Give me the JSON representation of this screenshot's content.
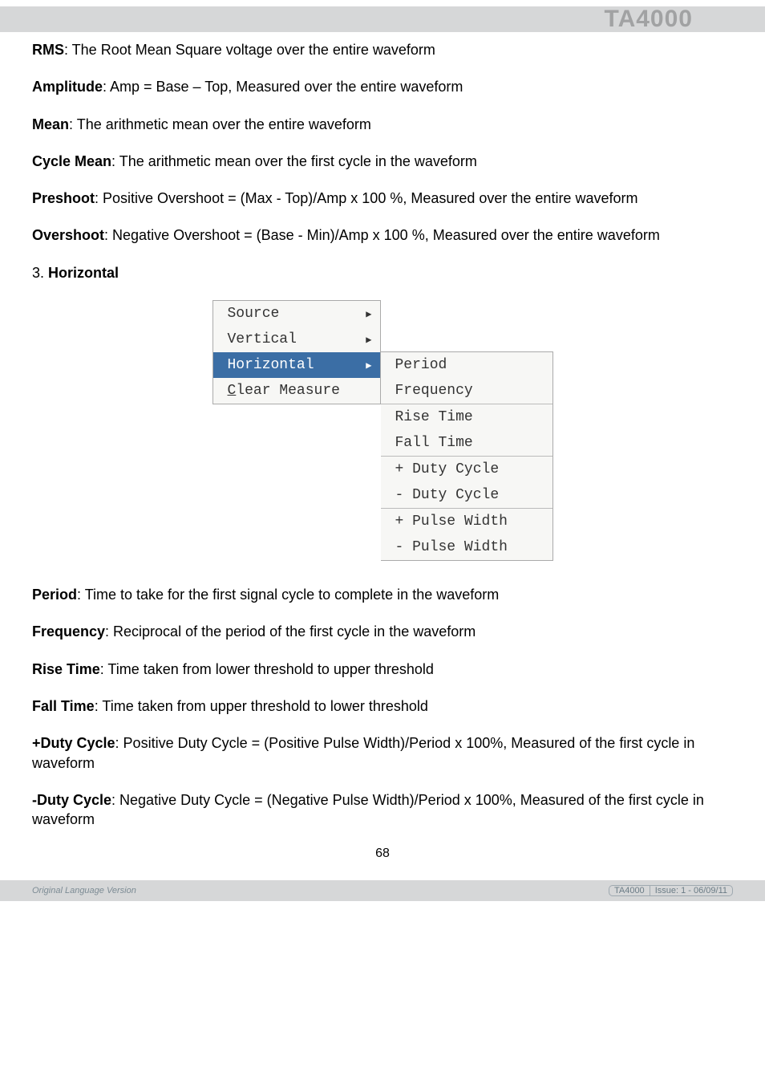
{
  "header": {
    "title": "TA4000"
  },
  "defs": {
    "rms": {
      "term": "RMS",
      "text": ": The Root Mean Square voltage over the entire waveform"
    },
    "amplitude": {
      "term": "Amplitude",
      "text": ": Amp = Base – Top, Measured over the entire waveform"
    },
    "mean": {
      "term": "Mean",
      "text": ": The arithmetic mean over the entire waveform"
    },
    "cycle_mean": {
      "term": "Cycle Mean",
      "text": ": The arithmetic mean over the first cycle in the waveform"
    },
    "preshoot": {
      "term": "Preshoot",
      "text": ": Positive Overshoot = (Max - Top)/Amp x 100 %, Measured over the entire waveform"
    },
    "overshoot": {
      "term": "Overshoot",
      "text": ": Negative Overshoot = (Base - Min)/Amp x 100 %, Measured over the entire waveform"
    }
  },
  "section": {
    "num": "3. ",
    "title": "Horizontal"
  },
  "menu": {
    "left": {
      "source": "Source",
      "vertical": "Vertical",
      "horizontal": "Horizontal",
      "clear": "Clear Measure"
    },
    "right": {
      "period": "Period",
      "frequency": "Frequency",
      "rise": "Rise Time",
      "fall": "Fall Time",
      "pduty": "+ Duty Cycle",
      "nduty": "- Duty Cycle",
      "ppulse": "+ Pulse Width",
      "npulse": "- Pulse Width"
    }
  },
  "defs2": {
    "period": {
      "term": "Period",
      "text": ": Time to take for the first signal cycle to complete in the waveform"
    },
    "frequency": {
      "term": "Frequency",
      "text": ": Reciprocal of the period of the first cycle in the waveform"
    },
    "rise": {
      "term": "Rise Time",
      "text": ": Time taken from lower threshold to upper threshold"
    },
    "fall": {
      "term": "Fall Time",
      "text": ": Time taken from upper threshold to lower threshold"
    },
    "pduty": {
      "term": "+Duty Cycle",
      "text": ": Positive Duty Cycle = (Positive Pulse Width)/Period x 100%, Measured of the first cycle in waveform"
    },
    "nduty": {
      "term": "-Duty Cycle",
      "text": ": Negative Duty Cycle = (Negative Pulse Width)/Period x 100%, Measured of the first cycle in waveform"
    }
  },
  "page_number": "68",
  "footer": {
    "left": "Original Language Version",
    "right1": "TA4000",
    "right2": "Issue: 1 - 06/09/11"
  }
}
